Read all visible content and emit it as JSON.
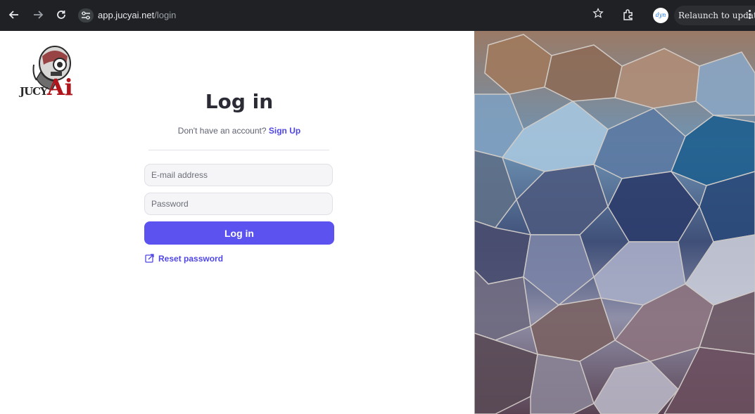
{
  "browser": {
    "url_host": "app.jucyai.net",
    "url_path": "/login",
    "relaunch_label": "Relaunch to update",
    "profile_initials": "dyn",
    "icons": [
      "back-arrow-icon",
      "forward-arrow-icon",
      "reload-icon",
      "site-settings-icon",
      "bookmark-star-icon",
      "extensions-icon",
      "kebab-menu-icon"
    ]
  },
  "logo": {
    "text_part1": "JUCY",
    "text_part2": "Ai"
  },
  "login": {
    "title": "Log in",
    "no_account_text": "Don't have an account?",
    "signup_link": "Sign Up",
    "email_placeholder": "E-mail address",
    "password_placeholder": "Password",
    "submit_label": "Log in",
    "reset_label": "Reset password",
    "reset_icon": "external-edit-icon"
  },
  "colors": {
    "accent": "#5b52f0",
    "link": "#4f46e5",
    "chrome_bg": "#202124",
    "logo_red": "#b1141b"
  }
}
